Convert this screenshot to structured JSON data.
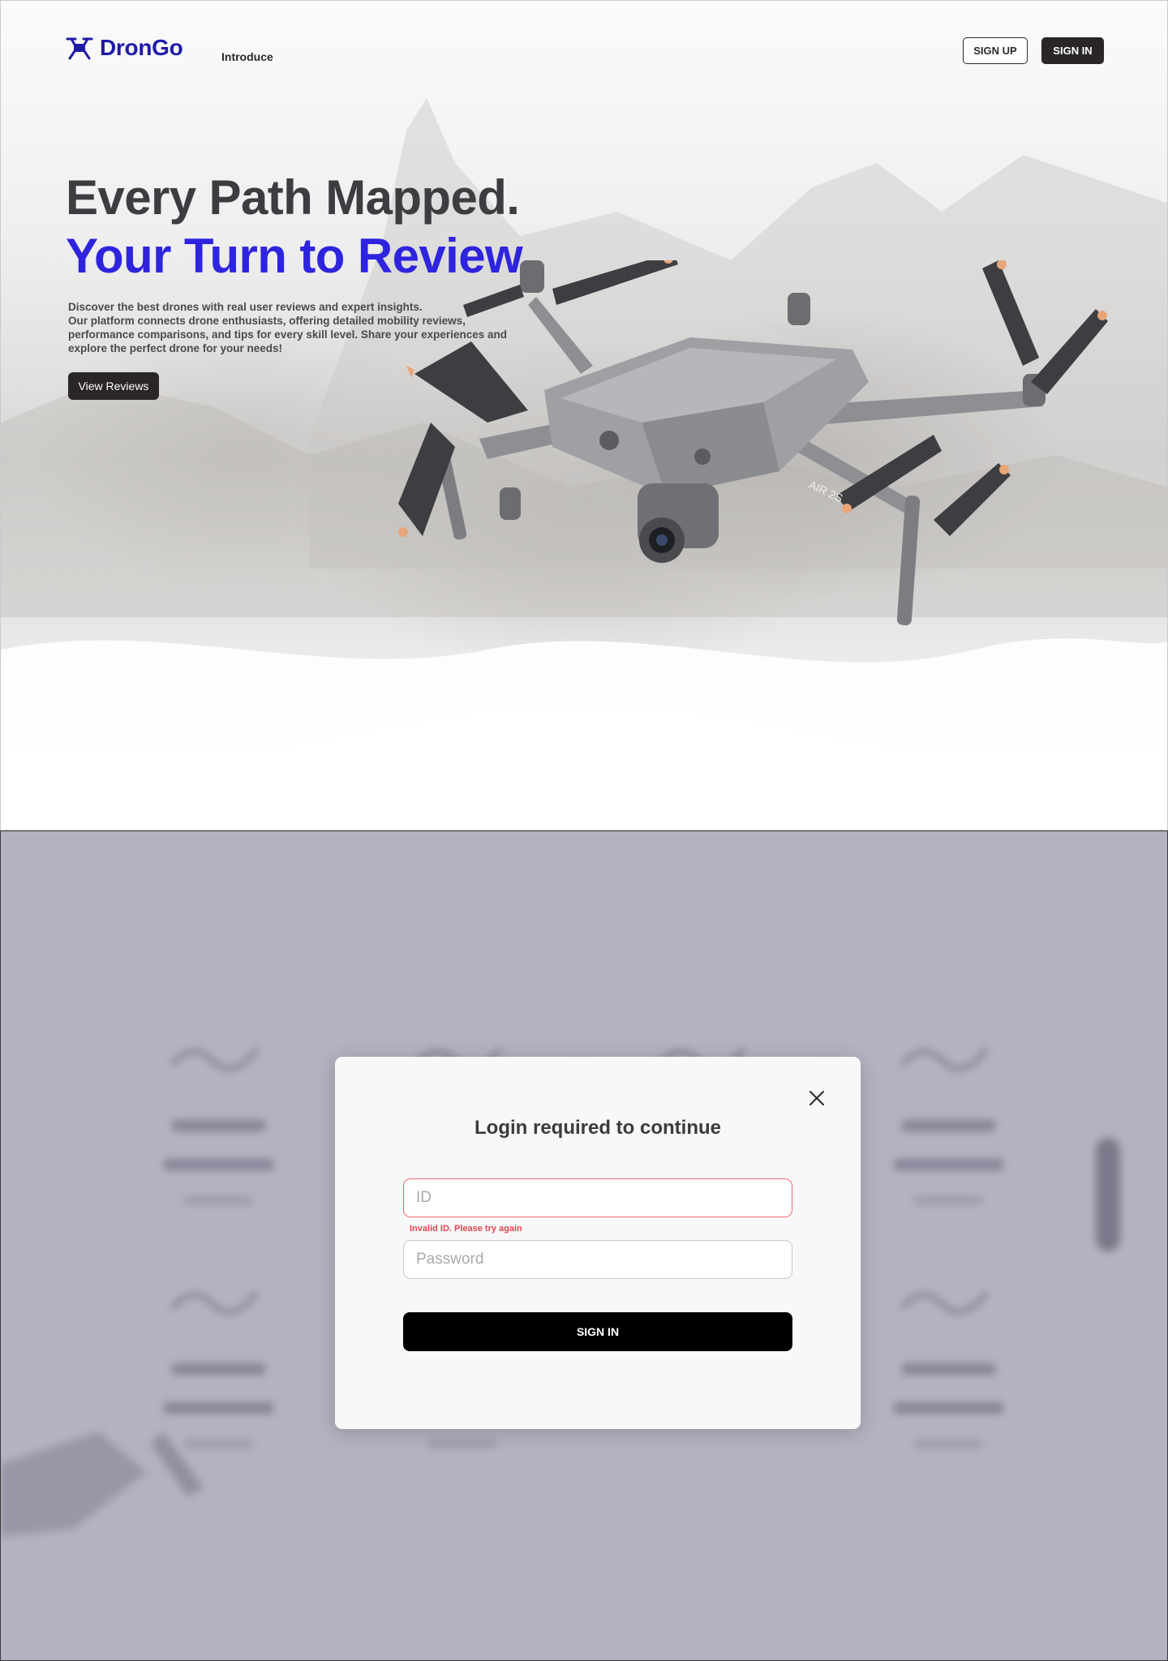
{
  "nav": {
    "logo_text": "DronGo",
    "links": [
      "Introduce"
    ],
    "signup_label": "SIGN UP",
    "signin_label": "SIGN IN"
  },
  "hero": {
    "headline_line1": "Every Path Mapped.",
    "headline_line2": "Your Turn to Review.",
    "description_lines": [
      "Discover the best drones with real user reviews and expert insights.",
      "Our platform connects drone enthusiasts, offering detailed mobility reviews,",
      "performance comparisons, and tips for every skill level. Share your experiences and",
      "explore the perfect drone for your needs!"
    ],
    "cta_label": "View Reviews",
    "drone_model_marking": "AIR 2S"
  },
  "login_modal": {
    "title": "Login required to continue",
    "id_placeholder": "ID",
    "id_error": "Invalid ID. Please try again",
    "password_placeholder": "Password",
    "submit_label": "SIGN IN"
  },
  "colors": {
    "brand": "#1f1aa8",
    "headline_accent": "#2f24dd",
    "dark_button": "#2a2627",
    "error": "#e2474f",
    "overlay": "#848299"
  }
}
